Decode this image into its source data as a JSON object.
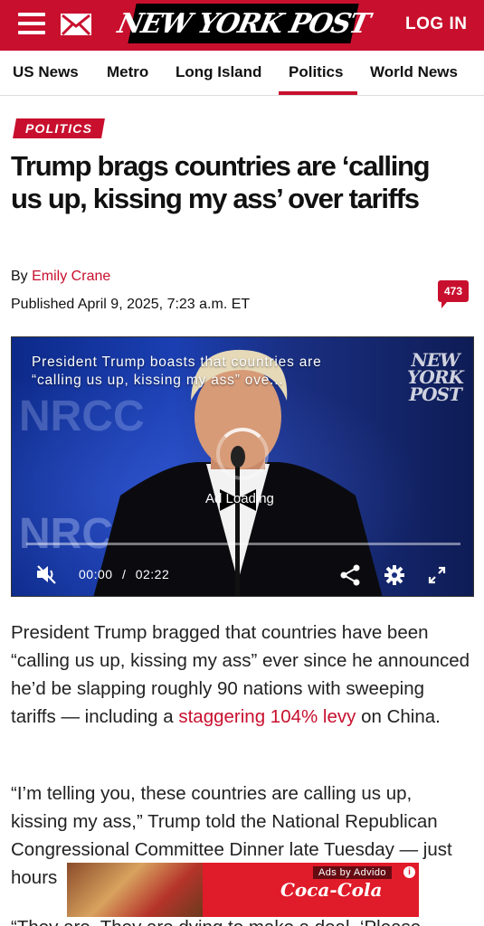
{
  "header": {
    "logo_text": "NEW YORK POST",
    "login_label": "LOG IN",
    "brand_color": "#c8102e",
    "icons": [
      "hamburger-menu-icon",
      "mail-icon"
    ]
  },
  "nav": {
    "items": [
      {
        "label": "US News"
      },
      {
        "label": "Metro"
      },
      {
        "label": "Long Island"
      },
      {
        "label": "Politics",
        "active": true
      },
      {
        "label": "World News"
      }
    ]
  },
  "article": {
    "section": "POLITICS",
    "headline": "Trump brags countries are ‘calling us up, kissing my ass’ over tariffs",
    "byline_prefix": "By",
    "author": "Emily Crane",
    "published": "Published April 9, 2025, 7:23 a.m. ET",
    "comment_count": "473"
  },
  "video": {
    "title": "President Trump boasts that countries are “calling us up, kissing my ass” ove...",
    "watermark": "NEW YORK POST",
    "backdrop_text": "NRCC",
    "status": "Ad Loading",
    "current_time": "00:00",
    "time_separator": "/",
    "duration": "02:22",
    "progress": 0,
    "controls": [
      "mute-icon",
      "share-icon",
      "settings-gear-icon",
      "fullscreen-icon"
    ]
  },
  "body": {
    "p1_before": "President Trump bragged that countries have been “calling us up, kissing my ass” ever since he announced he’d be slapping roughly 90 nations with sweeping tariffs — including a ",
    "p1_link": "staggering 104% levy",
    "p1_after": " on China.",
    "p2": "“I’m telling you, these countries are calling us up, kissing my ass,” Trump told the National Republican Congressional Committee Dinner late Tuesday — just hours",
    "p3": "“They are. They are dying to make a deal. ‘Please,"
  },
  "ad": {
    "label": "Ads by Advido",
    "info": "i",
    "brand": "Coca-Cola"
  }
}
